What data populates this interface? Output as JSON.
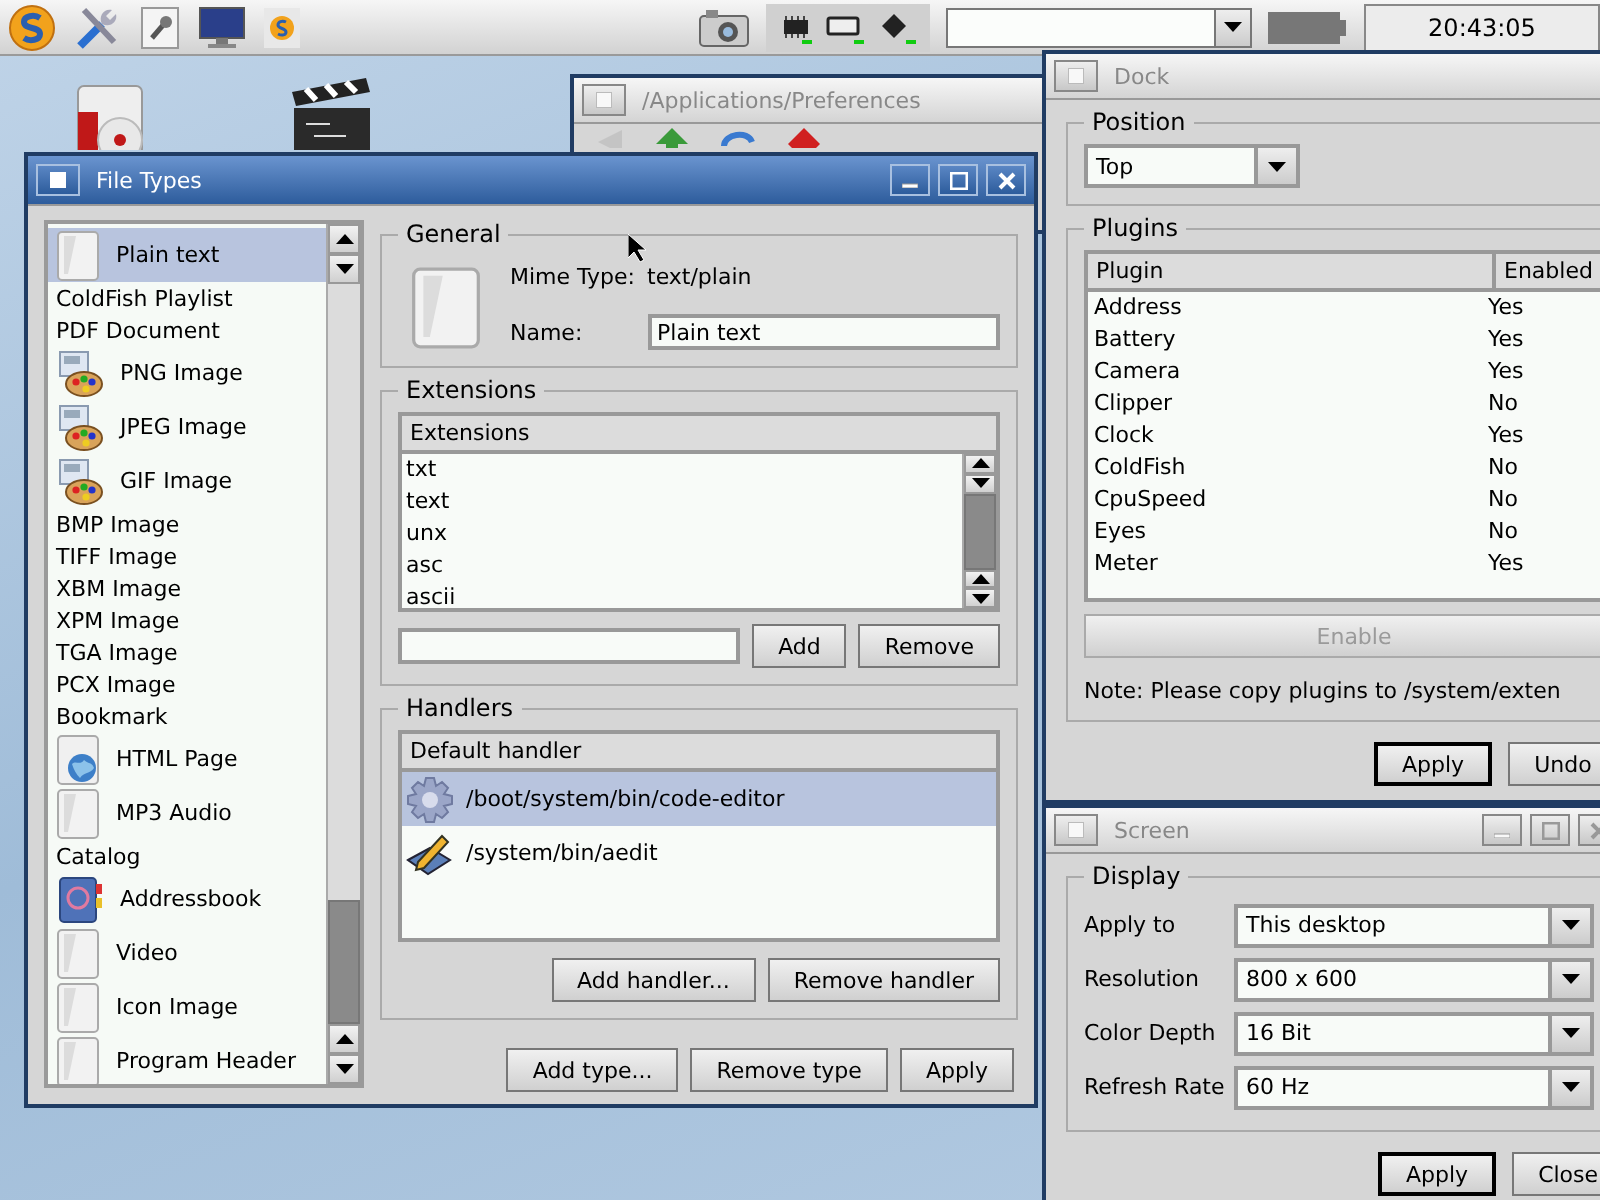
{
  "top_bar": {
    "clock": "20:43:05"
  },
  "preferences_window": {
    "title": "/Applications/Preferences",
    "active": false
  },
  "file_types_window": {
    "title": "File Types",
    "active": true,
    "types": [
      {
        "label": "Plain text",
        "kind": "document",
        "selected": true
      },
      {
        "label": "ColdFish Playlist",
        "kind": "plain",
        "selected": false
      },
      {
        "label": "PDF Document",
        "kind": "plain",
        "selected": false
      },
      {
        "label": "PNG Image",
        "kind": "image",
        "selected": false
      },
      {
        "label": "JPEG Image",
        "kind": "image",
        "selected": false
      },
      {
        "label": "GIF Image",
        "kind": "image",
        "selected": false
      },
      {
        "label": "BMP Image",
        "kind": "plain",
        "selected": false
      },
      {
        "label": "TIFF Image",
        "kind": "plain",
        "selected": false
      },
      {
        "label": "XBM Image",
        "kind": "plain",
        "selected": false
      },
      {
        "label": "XPM Image",
        "kind": "plain",
        "selected": false
      },
      {
        "label": "TGA Image",
        "kind": "plain",
        "selected": false
      },
      {
        "label": "PCX Image",
        "kind": "plain",
        "selected": false
      },
      {
        "label": "Bookmark",
        "kind": "plain",
        "selected": false
      },
      {
        "label": "HTML Page",
        "kind": "globe",
        "selected": false
      },
      {
        "label": "MP3 Audio",
        "kind": "document",
        "selected": false
      },
      {
        "label": "Catalog",
        "kind": "plain",
        "selected": false
      },
      {
        "label": "Addressbook",
        "kind": "book",
        "selected": false
      },
      {
        "label": "Video",
        "kind": "document",
        "selected": false
      },
      {
        "label": "Icon Image",
        "kind": "document",
        "selected": false
      },
      {
        "label": "Program Header",
        "kind": "document",
        "selected": false
      }
    ],
    "general": {
      "title": "General",
      "mime_label": "Mime Type:",
      "mime_value": "text/plain",
      "name_label": "Name:",
      "name_value": "Plain text"
    },
    "extensions": {
      "title": "Extensions",
      "column": "Extensions",
      "items": [
        "txt",
        "text",
        "unx",
        "asc",
        "ascii"
      ],
      "buttons": [
        {
          "label": "Add",
          "default": false
        },
        {
          "label": "Remove",
          "default": false
        }
      ]
    },
    "handlers": {
      "title": "Handlers",
      "column": "Default handler",
      "items": [
        {
          "path": "/boot/system/bin/code-editor",
          "kind": "gear",
          "selected": true
        },
        {
          "path": "/system/bin/aedit",
          "kind": "pencil",
          "selected": false
        }
      ],
      "buttons": [
        {
          "label": "Add handler...",
          "default": false
        },
        {
          "label": "Remove handler",
          "default": false
        }
      ]
    },
    "buttons": [
      {
        "label": "Add type...",
        "default": false
      },
      {
        "label": "Remove type",
        "default": false
      },
      {
        "label": "Apply",
        "default": false
      }
    ]
  },
  "dock_window": {
    "title": "Dock",
    "active": false,
    "position": {
      "title": "Position",
      "value": "Top"
    },
    "plugins": {
      "title": "Plugins",
      "columns": [
        "Plugin",
        "Enabled"
      ],
      "rows": [
        {
          "plugin": "Address",
          "enabled": "Yes"
        },
        {
          "plugin": "Battery",
          "enabled": "Yes"
        },
        {
          "plugin": "Camera",
          "enabled": "Yes"
        },
        {
          "plugin": "Clipper",
          "enabled": "No"
        },
        {
          "plugin": "Clock",
          "enabled": "Yes"
        },
        {
          "plugin": "ColdFish",
          "enabled": "No"
        },
        {
          "plugin": "CpuSpeed",
          "enabled": "No"
        },
        {
          "plugin": "Eyes",
          "enabled": "No"
        },
        {
          "plugin": "Meter",
          "enabled": "Yes"
        }
      ],
      "enable_button": {
        "label": "Enable",
        "disabled": true
      },
      "note": "Note: Please copy plugins to /system/exten"
    },
    "buttons": [
      {
        "label": "Apply",
        "default": true
      },
      {
        "label": "Undo",
        "default": false
      }
    ]
  },
  "screen_window": {
    "title": "Screen",
    "active": false,
    "group": "Display",
    "rows": [
      {
        "label": "Apply to",
        "value": "This desktop"
      },
      {
        "label": "Resolution",
        "value": "800 x 600"
      },
      {
        "label": "Color Depth",
        "value": "16 Bit"
      },
      {
        "label": "Refresh Rate",
        "value": "60 Hz"
      }
    ],
    "buttons": [
      {
        "label": "Apply",
        "default": true
      },
      {
        "label": "Close",
        "default": false
      }
    ]
  }
}
